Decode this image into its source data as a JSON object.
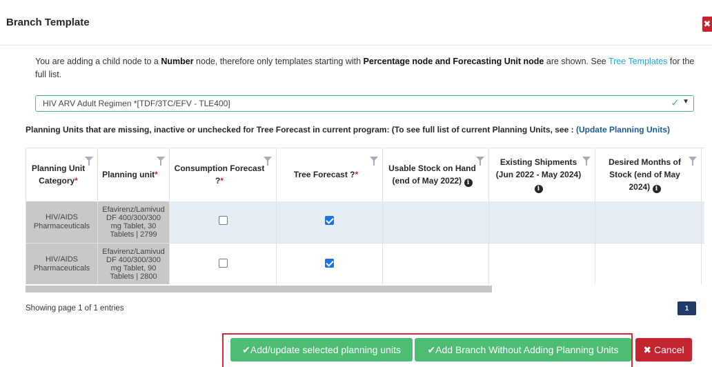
{
  "modal": {
    "title": "Branch Template",
    "close_icon": "x-icon"
  },
  "info": {
    "part1": "You are adding a child node to a ",
    "node_type": "Number",
    "part2": " node, therefore only templates starting with ",
    "allowed_types": "Percentage node and Forecasting Unit node",
    "part3": " are shown. See ",
    "link_text": "Tree Templates",
    "part4": " for the full list."
  },
  "template_select": {
    "value": "HIV ARV Adult Regimen *[TDF/3TC/EFV - TLE400]"
  },
  "missing": {
    "heading": "Planning Units that are missing, inactive or unchecked for Tree Forecast in current program: (To see full list of current Planning Units, see : ",
    "link_text": "(Update Planning Units)"
  },
  "table": {
    "columns": [
      {
        "label": "Planning Unit Category",
        "required": "*"
      },
      {
        "label": "Planning unit",
        "required": "*"
      },
      {
        "label": "Consumption Forecast ?",
        "required": "*"
      },
      {
        "label": "Tree Forecast ?",
        "required": "*"
      },
      {
        "label": "Usable Stock on Hand (end of May 2022)",
        "required": ""
      },
      {
        "label": "Existing Shipments (Jun 2022 - May 2024)",
        "required": ""
      },
      {
        "label": "Desired Months of Stock (end of May 2024)",
        "required": ""
      }
    ],
    "rows": [
      {
        "category_1": "HIV/AIDS",
        "category_2": "Pharmaceuticals",
        "pu_1": "Efavirenz/Lamivud",
        "pu_2": "DF 400/300/300",
        "pu_3": "mg Tablet, 30",
        "pu_4": "Tablets | 2799",
        "consumption": false,
        "tree": true
      },
      {
        "category_1": "HIV/AIDS",
        "category_2": "Pharmaceuticals",
        "pu_1": "Efavirenz/Lamivud",
        "pu_2": "DF 400/300/300",
        "pu_3": "mg Tablet, 90",
        "pu_4": "Tablets | 2800",
        "consumption": false,
        "tree": true
      }
    ]
  },
  "pagination": {
    "showing": "Showing page 1 of 1 entries",
    "page": "1"
  },
  "buttons": {
    "add_update": "✔Add/update selected planning units",
    "add_branch": "✔Add Branch Without Adding Planning Units",
    "cancel": "✖ Cancel"
  }
}
